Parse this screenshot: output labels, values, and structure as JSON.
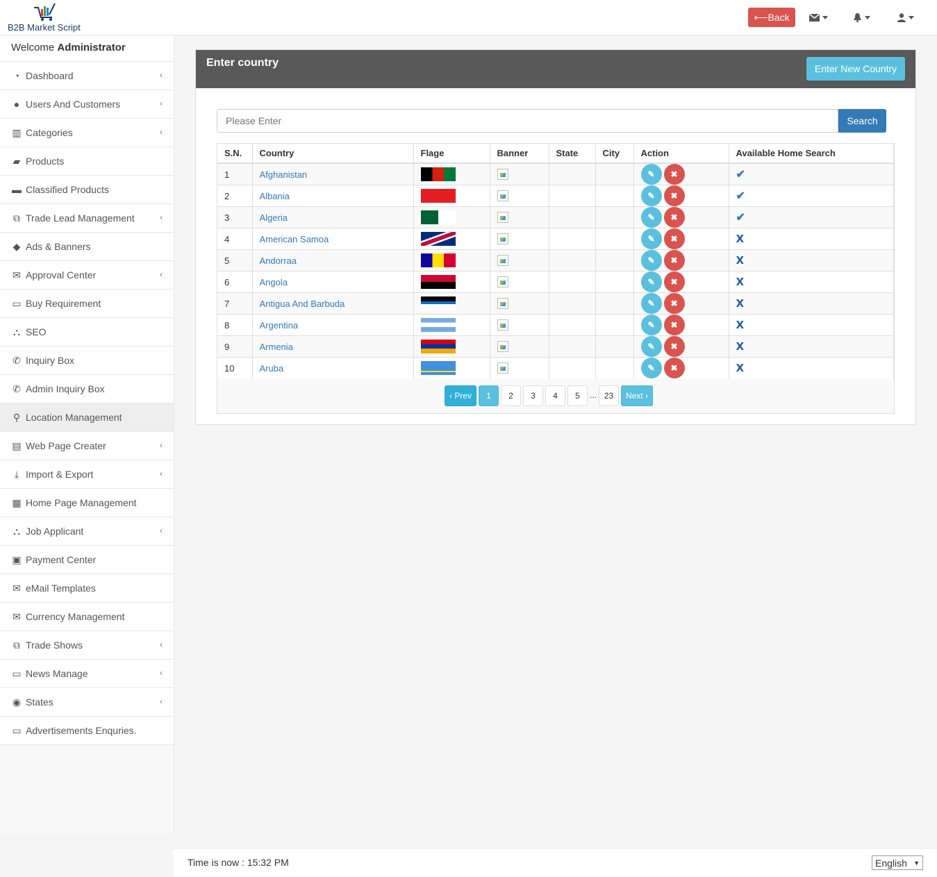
{
  "brand": {
    "name": "B2B Market Script"
  },
  "topbar": {
    "back_label": "Back",
    "icons": [
      "envelope-icon",
      "bell-icon",
      "user-icon"
    ]
  },
  "sidebar": {
    "welcome_prefix": "Welcome",
    "welcome_user": "Administrator",
    "items": [
      {
        "label": "Dashboard",
        "icon": "dashboard-icon",
        "submenu": true
      },
      {
        "label": "Users And Customers",
        "icon": "user-icon",
        "submenu": true
      },
      {
        "label": "Categories",
        "icon": "bar-chart-icon",
        "submenu": true
      },
      {
        "label": "Products",
        "icon": "briefcase-icon",
        "submenu": false
      },
      {
        "label": "Classified Products",
        "icon": "archive-icon",
        "submenu": false
      },
      {
        "label": "Trade Lead Management",
        "icon": "copy-icon",
        "submenu": true
      },
      {
        "label": "Ads & Banners",
        "icon": "tags-icon",
        "submenu": false
      },
      {
        "label": "Approval Center",
        "icon": "envelope-icon",
        "submenu": true
      },
      {
        "label": "Buy Requirement",
        "icon": "credit-card-icon",
        "submenu": false
      },
      {
        "label": "SEO",
        "icon": "sitemap-icon",
        "submenu": false
      },
      {
        "label": "Inquiry Box",
        "icon": "phone-icon",
        "submenu": false
      },
      {
        "label": "Admin Inquiry Box",
        "icon": "phone-icon",
        "submenu": false
      },
      {
        "label": "Location Management",
        "icon": "map-marker-icon",
        "submenu": false,
        "active": true
      },
      {
        "label": "Web Page Creater",
        "icon": "file-icon",
        "submenu": true
      },
      {
        "label": "Import & Export",
        "icon": "download-icon",
        "submenu": true
      },
      {
        "label": "Home Page Management",
        "icon": "table-icon",
        "submenu": false
      },
      {
        "label": "Job Applicant",
        "icon": "sitemap-icon",
        "submenu": true
      },
      {
        "label": "Payment Center",
        "icon": "money-icon",
        "submenu": false
      },
      {
        "label": "eMail Templates",
        "icon": "envelope-icon",
        "submenu": false
      },
      {
        "label": "Currency Management",
        "icon": "envelope-icon",
        "submenu": false
      },
      {
        "label": "Trade Shows",
        "icon": "copy-icon",
        "submenu": true
      },
      {
        "label": "News Manage",
        "icon": "desktop-icon",
        "submenu": true
      },
      {
        "label": "States",
        "icon": "eye-icon",
        "submenu": true
      },
      {
        "label": "Advertisements Enquries.",
        "icon": "desktop-icon",
        "submenu": false
      }
    ]
  },
  "panel": {
    "title": "Enter country",
    "new_button": "Enter New Country"
  },
  "search": {
    "placeholder": "Please Enter",
    "button": "Search"
  },
  "table": {
    "headers": [
      "S.N.",
      "Country",
      "Flage",
      "Banner",
      "State",
      "City",
      "Action",
      "Available Home Search"
    ],
    "rows": [
      {
        "sn": "1",
        "country": "Afghanistan",
        "home_search": true
      },
      {
        "sn": "2",
        "country": "Albania",
        "home_search": true
      },
      {
        "sn": "3",
        "country": "Algeria",
        "home_search": true
      },
      {
        "sn": "4",
        "country": "American Samoa",
        "home_search": false
      },
      {
        "sn": "5",
        "country": "Andorraa",
        "home_search": false
      },
      {
        "sn": "6",
        "country": "Angola",
        "home_search": false
      },
      {
        "sn": "7",
        "country": "Antigua And Barbuda",
        "home_search": false
      },
      {
        "sn": "8",
        "country": "Argentina",
        "home_search": false
      },
      {
        "sn": "9",
        "country": "Armenia",
        "home_search": false
      },
      {
        "sn": "10",
        "country": "Aruba",
        "home_search": false
      }
    ]
  },
  "pagination": {
    "prev": "‹ Prev",
    "pages": [
      "1",
      "2",
      "3",
      "4",
      "5"
    ],
    "ellipsis": "...",
    "last": "23",
    "next": "Next ›",
    "current": "1"
  },
  "footer": {
    "time_label": "Time is now : 15:32 PM",
    "language": "English"
  },
  "colors": {
    "danger": "#d9534f",
    "info": "#5bc0de",
    "primary": "#337ab7",
    "panel_header": "#595959"
  }
}
